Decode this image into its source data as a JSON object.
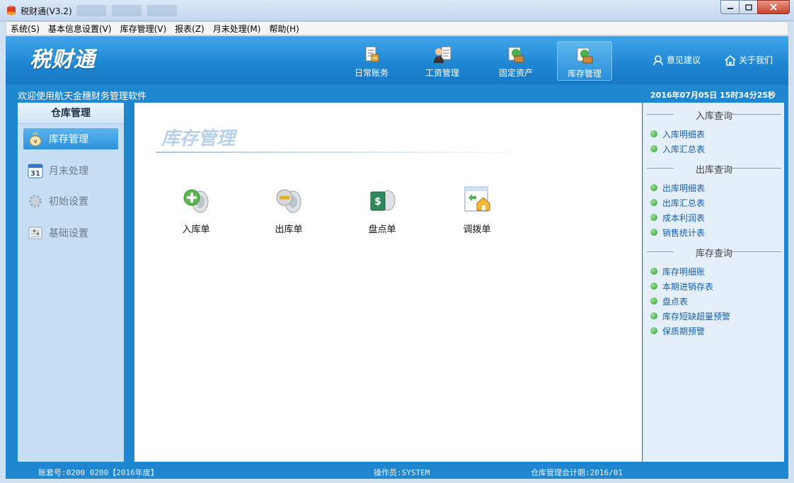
{
  "window": {
    "title": "税财通(V3.2)"
  },
  "menu": [
    "系统(S)",
    "基本信息设置(V)",
    "库存管理(V)",
    "报表(Z)",
    "月末处理(M)",
    "帮助(H)"
  ],
  "header": {
    "logo": "税财通",
    "nav": [
      {
        "label": "日常账务",
        "icon": "ledger-icon"
      },
      {
        "label": "工资管理",
        "icon": "payroll-icon"
      },
      {
        "label": "固定资产",
        "icon": "fixed-asset-icon"
      },
      {
        "label": "库存管理",
        "icon": "inventory-icon",
        "active": true
      }
    ],
    "feedback": "意见建议",
    "about": "关于我们"
  },
  "welcome": "欢迎使用航天金穗财务管理软件",
  "datetime": "2016年07月05日 15时34分25秒",
  "sidebar": {
    "title": "仓库管理",
    "items": [
      {
        "label": "库存管理",
        "icon": "money-bag-icon",
        "active": true
      },
      {
        "label": "月末处理",
        "icon": "calendar-icon"
      },
      {
        "label": "初始设置",
        "icon": "gear-icon"
      },
      {
        "label": "基础设置",
        "icon": "settings-panel-icon"
      }
    ]
  },
  "main": {
    "title": "库存管理",
    "actions": [
      {
        "label": "入库单",
        "icon": "stock-in-icon"
      },
      {
        "label": "出库单",
        "icon": "stock-out-icon"
      },
      {
        "label": "盘点单",
        "icon": "stocktake-icon"
      },
      {
        "label": "调拨单",
        "icon": "transfer-icon"
      }
    ]
  },
  "rpanel": {
    "sections": [
      {
        "title": "入库查询",
        "links": [
          "入库明细表",
          "入库汇总表"
        ]
      },
      {
        "title": "出库查询",
        "links": [
          "出库明细表",
          "出库汇总表",
          "成本利润表",
          "销售统计表"
        ]
      },
      {
        "title": "库存查询",
        "links": [
          "库存明细账",
          "本期进销存表",
          "盘点表",
          "库存短缺超量预警",
          "保质期预警"
        ]
      }
    ]
  },
  "status": {
    "account": "账套号:0200 0200【2016年度】",
    "operator": "操作员:SYSTEM",
    "period": "仓库管理会计期:2016/01"
  }
}
